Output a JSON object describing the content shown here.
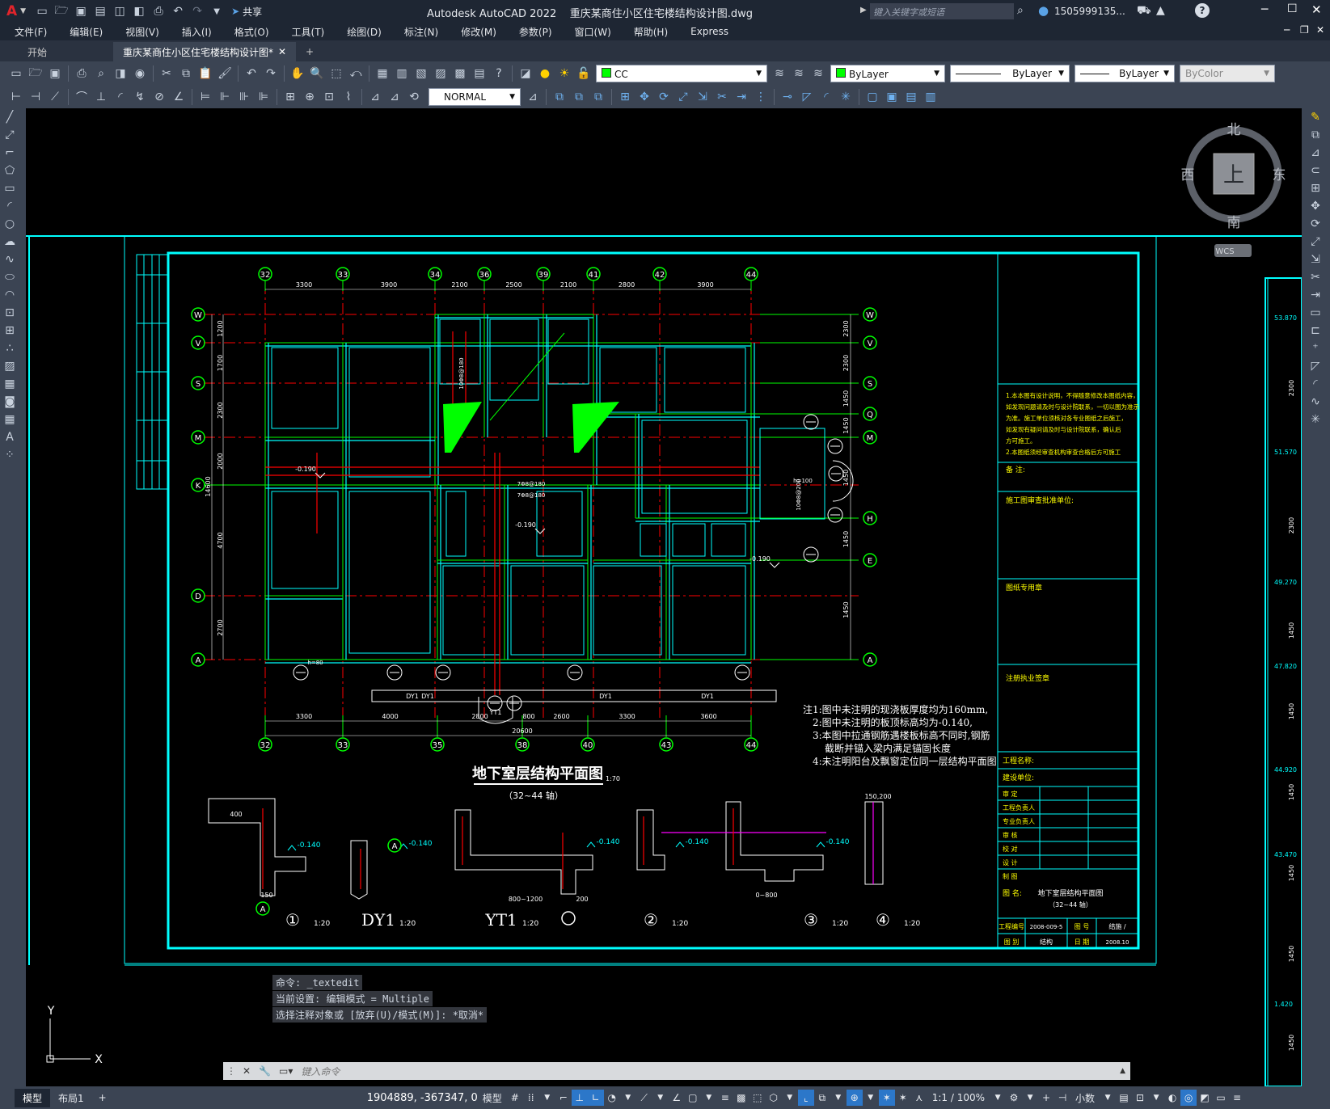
{
  "colors": {
    "title_bg": "#1e2633",
    "toolbar_bg": "#3b4453",
    "canvas_bg": "#000000",
    "cyan": "#00ffff",
    "green": "#00ff00",
    "red": "#ff0000",
    "yellow": "#ffff00",
    "white": "#ffffff"
  },
  "titlebar": {
    "app_letter": "A",
    "share": "共享",
    "title": "Autodesk AutoCAD 2022    重庆某商住小区住宅楼结构设计图.dwg",
    "search_placeholder": "键入关键字或短语",
    "user": "1505999135...",
    "help": "?"
  },
  "menu": [
    "文件(F)",
    "编辑(E)",
    "视图(V)",
    "插入(I)",
    "格式(O)",
    "工具(T)",
    "绘图(D)",
    "标注(N)",
    "修改(M)",
    "参数(P)",
    "窗口(W)",
    "帮助(H)",
    "Express"
  ],
  "tabs": {
    "start": "开始",
    "doc": "重庆某商住小区住宅楼结构设计图*",
    "close": "✕",
    "add": "+"
  },
  "toolbar1": {
    "layer": "CC",
    "color": "ByLayer",
    "linetype": "ByLayer",
    "lineweight": "ByLayer",
    "plotstyle": "ByColor"
  },
  "toolbar2": {
    "dimstyle": "NORMAL"
  },
  "viewcube": {
    "north": "北",
    "south": "南",
    "east": "东",
    "west": "西",
    "face": "上",
    "wcs": "WCS"
  },
  "drawing": {
    "top_axes": [
      "32",
      "33",
      "34",
      "36",
      "39",
      "41",
      "42",
      "44"
    ],
    "top_dims": [
      "3300",
      "3900",
      "2100",
      "2500",
      "2100",
      "2800",
      "3900"
    ],
    "bottom_axes": [
      "32",
      "33",
      "35",
      "38",
      "40",
      "43",
      "44"
    ],
    "bottom_dims": [
      "3300",
      "4000",
      "2800",
      "800",
      "2600",
      "3300",
      "3600"
    ],
    "total_dim": "20600",
    "left_axes": [
      "W",
      "V",
      "S",
      "M",
      "K",
      "D",
      "A"
    ],
    "right_axes": [
      "W",
      "V",
      "S",
      "Q",
      "M",
      "H",
      "E",
      "A"
    ],
    "left_dims": [
      "1200",
      "1700",
      "2300",
      "2000",
      "4700",
      "2700"
    ],
    "left_total": "14600",
    "right_dims": [
      "2300",
      "2300",
      "1450",
      "1450",
      "1450",
      "1450",
      "1450",
      "1450"
    ],
    "title": "地下室层结构平面图",
    "title_scale": "1:70",
    "subtitle": "（32~44 轴）",
    "notes": [
      "注1:图中未注明的现浇板厚度均为160mm,",
      "2:图中未注明的板顶标高均为-0.140,",
      "3:本图中拉通钢筋遇楼板标高不同时,钢筋",
      "截断并锚入梁内满足锚固长度",
      "4:未注明阳台及飘窗定位同一层结构平面图"
    ],
    "level_labels": [
      "-0.190",
      "-0.190",
      "-0.190"
    ],
    "h_labels": [
      "h=100",
      "h=80"
    ],
    "bar_labels": [
      "7Φ8@180",
      "7Φ8@180",
      "10Φ8@180",
      "10Φ8@200"
    ],
    "dy_labels": [
      "DY1",
      "DY1",
      "DY1",
      "DY1",
      "YT1"
    ],
    "details": [
      {
        "label": "①",
        "scale": "1:20"
      },
      {
        "label": "DY1",
        "scale": "1:20"
      },
      {
        "label": "YT1",
        "scale": "1:20"
      },
      {
        "label": "②",
        "scale": "1:20"
      },
      {
        "label": "③",
        "scale": "1:20"
      },
      {
        "label": "④",
        "scale": "1:20"
      }
    ],
    "detail_levels": [
      "-0.140",
      "-0.140",
      "-0.140",
      "-0.140",
      "-0.140"
    ],
    "detail_dims": [
      "400",
      "150",
      "800~1200",
      "0~800",
      "150,200",
      "200"
    ],
    "title_block": {
      "notes": [
        "1.本本图有设计说明，不得随意修改本图纸内容，",
        "如发现问题请及时与设计院联系，一切以图为准示",
        "为准。施工单位须核对各专业图纸之后施工，",
        "如发现有疑问请及时与设计院联系，确认后",
        "方可施工。",
        "2.本图纸须经审查机构审查合格后方可施工"
      ],
      "remark": "备  注:",
      "review": "施工图审查批准单位:",
      "seal": "图纸专用章",
      "reg": "注册执业签章",
      "project": "工程名称:",
      "client": "建设单位:",
      "roles": [
        "审    定",
        "工程负责人",
        "专业负责人",
        "审    核",
        "校    对",
        "设    计",
        "制    图"
      ],
      "drawing_name_label": "图  名:",
      "drawing_name": "地下室层结构平面图",
      "drawing_axes": "（32~44 轴）",
      "no_label": "工程编号",
      "no": "2008-009-5",
      "fig_label": "图  号",
      "fig": "结施  /",
      "spec_label": "图  别",
      "spec": "结构",
      "date_label": "日  期",
      "date": "2008.10"
    },
    "right_levels": [
      "53.870",
      "51.570",
      "49.270",
      "47.820",
      "44.920",
      "43.470",
      "1.420"
    ]
  },
  "ucs": {
    "x": "X",
    "y": "Y"
  },
  "command": {
    "line1": "命令: _textedit",
    "line2": "当前设置: 编辑模式 = Multiple",
    "line3": "选择注释对象或 [放弃(U)/模式(M)]: *取消*",
    "placeholder": "键入命令"
  },
  "status": {
    "model_tab": "模型",
    "layout_tab": "布局1",
    "add": "+",
    "coords": "1904889, -367347, 0",
    "model": "模型",
    "scale": "1:1 / 100%",
    "units": "小数"
  }
}
